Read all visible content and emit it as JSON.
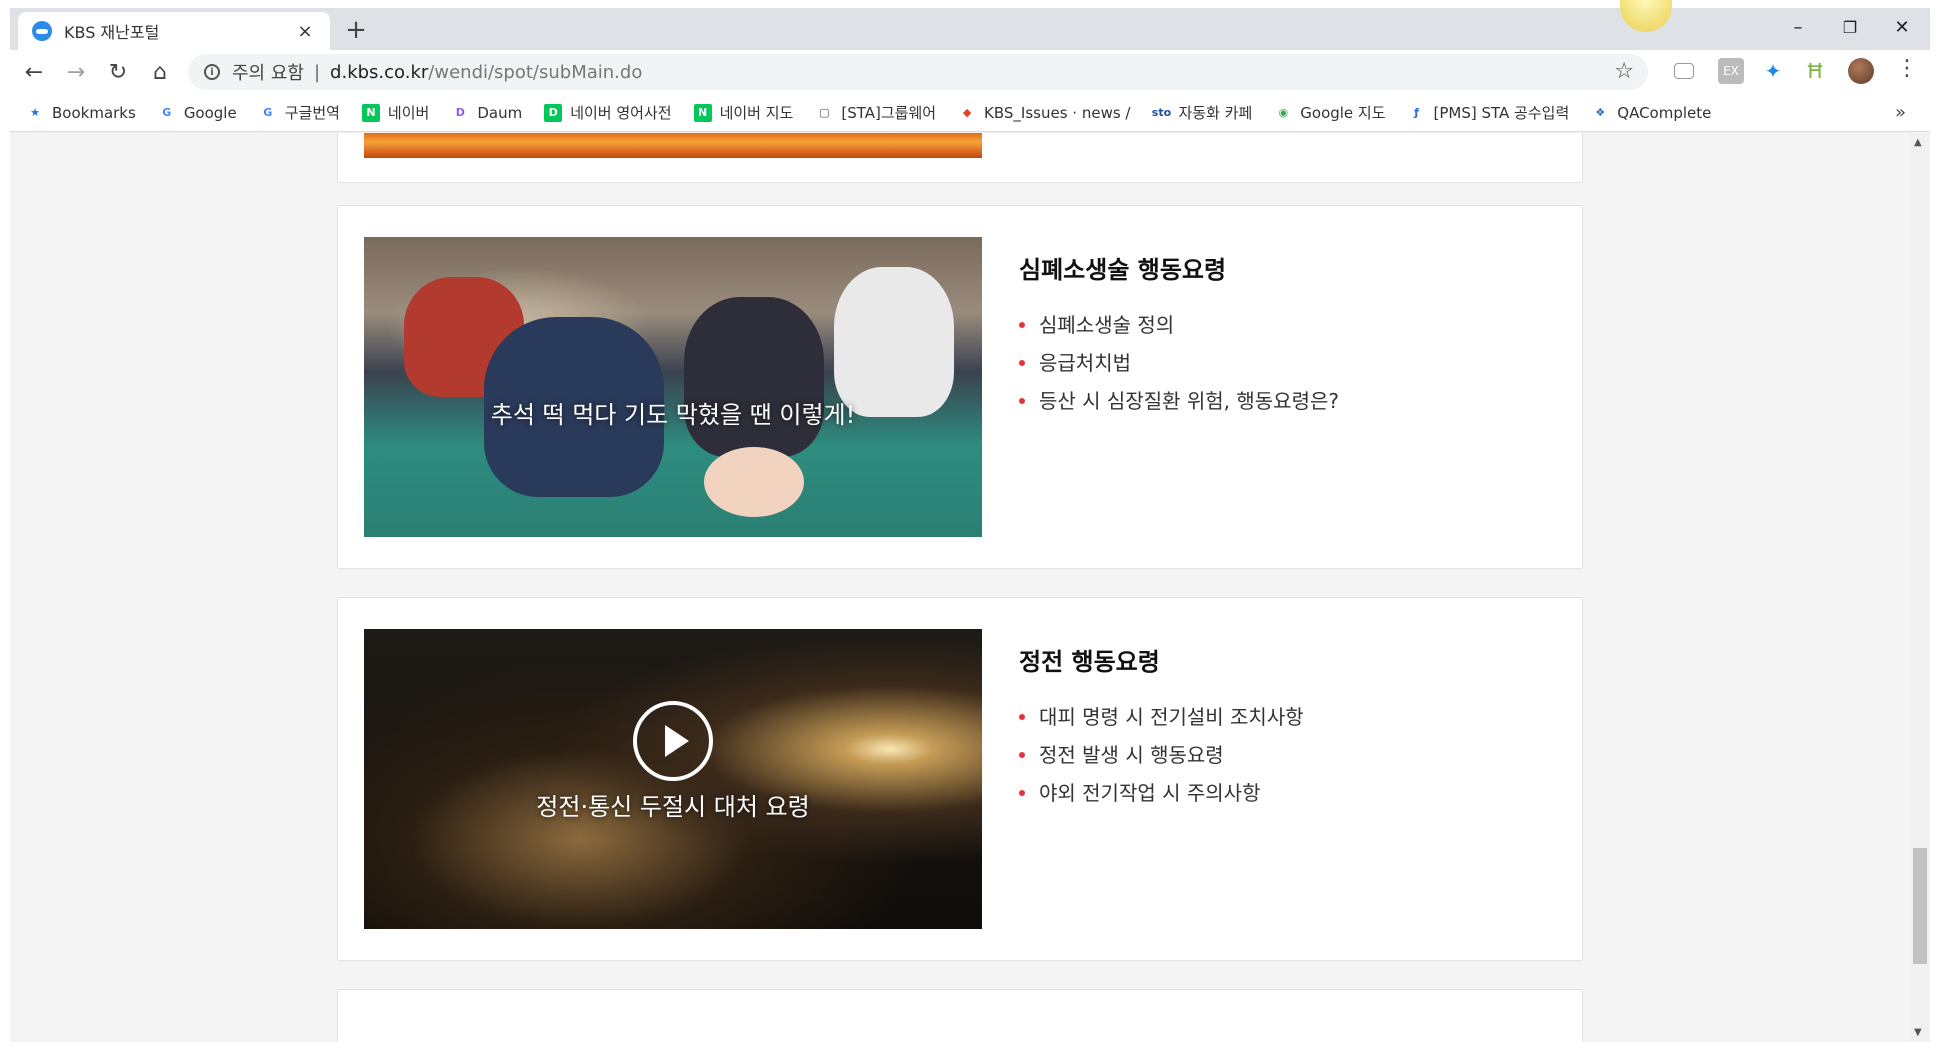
{
  "browser": {
    "tab_title": "KBS 재난포털",
    "tab_close": "×",
    "new_tab": "+",
    "security_label": "주의 요함",
    "url_separator": "|",
    "url_host": "d.kbs.co.kr",
    "url_path": "/wendi/spot/subMain.do",
    "window_controls": {
      "minimize": "–",
      "restore": "❐",
      "close": "✕"
    },
    "nav": {
      "back": "←",
      "forward": "→",
      "reload": "↻",
      "home": "⌂"
    },
    "star": "☆",
    "menu": "⋮",
    "extensions": [
      "cast-icon",
      "ex-extension-icon",
      "kite-icon",
      "ladder-icon"
    ]
  },
  "bookmarks": {
    "items": [
      {
        "label": "Bookmarks",
        "icon": "star-icon",
        "color": "#1a73e8"
      },
      {
        "label": "Google",
        "icon": "google-icon",
        "color": "#4285f4"
      },
      {
        "label": "구글번역",
        "icon": "translate-icon",
        "color": "#4285f4"
      },
      {
        "label": "네이버",
        "icon": "naver-icon",
        "color": "#03c75a"
      },
      {
        "label": "Daum",
        "icon": "daum-icon",
        "color": "#8a5cf5"
      },
      {
        "label": "네이버 영어사전",
        "icon": "naver-dict-icon",
        "color": "#03c75a"
      },
      {
        "label": "네이버 지도",
        "icon": "naver-map-icon",
        "color": "#03c75a"
      },
      {
        "label": "[STA]그룹웨어",
        "icon": "page-icon",
        "color": "#555555"
      },
      {
        "label": "KBS_Issues · news / ",
        "icon": "gitlab-icon",
        "color": "#e24329"
      },
      {
        "label": "자동화 카페",
        "icon": "sto-icon",
        "color": "#1a4fa0"
      },
      {
        "label": "Google 지도",
        "icon": "google-maps-icon",
        "color": "#34a853"
      },
      {
        "label": "[PMS] STA 공수입력",
        "icon": "pms-icon",
        "color": "#3367d6"
      },
      {
        "label": "QAComplete",
        "icon": "qacomplete-icon",
        "color": "#2a6ebb"
      }
    ],
    "more": "»"
  },
  "cards": [
    {
      "title": "심폐소생술 행동요령",
      "thumb_caption": "추석 떡 먹다 기도 막혔을 땐 이렇게!",
      "items": [
        "심폐소생술 정의",
        "응급처치법",
        "등산 시 심장질환 위험, 행동요령은?"
      ]
    },
    {
      "title": "정전 행동요령",
      "thumb_caption": "정전·통신 두절시 대처 요령",
      "items": [
        "대피 명령 시 전기설비 조치사항",
        "정전 발생 시 행동요령",
        "야외 전기작업 시 주의사항"
      ]
    }
  ],
  "colors": {
    "bullet": "#e8313f",
    "chrome": "#dee1e6",
    "page_bg": "#f4f4f4"
  }
}
